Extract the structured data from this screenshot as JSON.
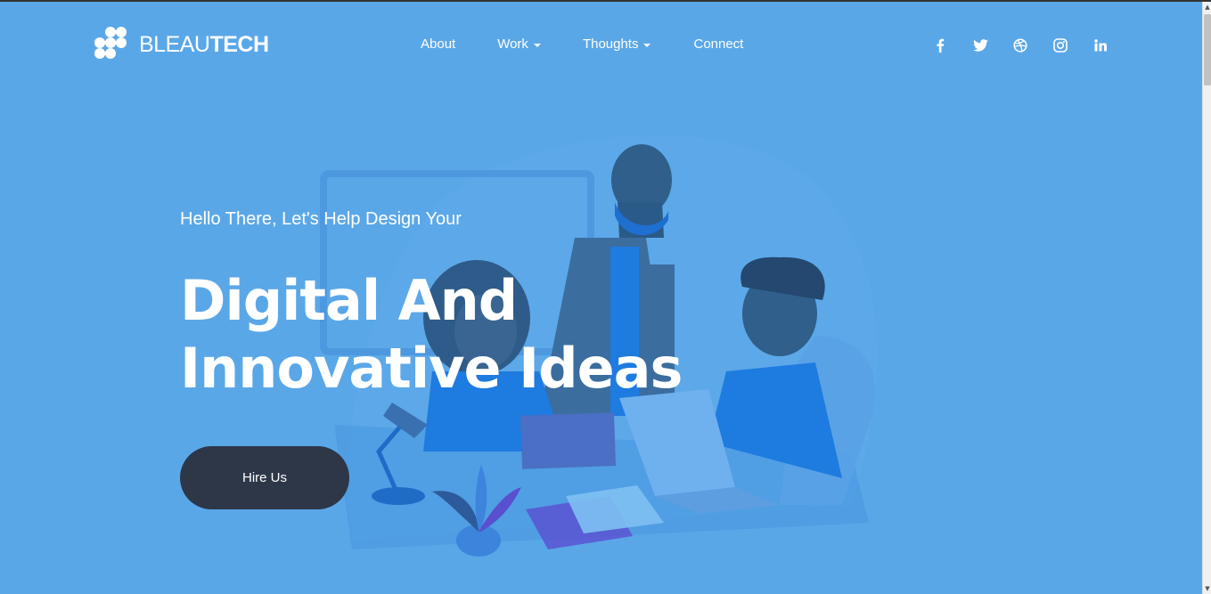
{
  "brand": {
    "light": "BLEAU",
    "bold": "TECH"
  },
  "nav": {
    "about": "About",
    "work": "Work",
    "thoughts": "Thoughts",
    "connect": "Connect"
  },
  "social": [
    "facebook-icon",
    "twitter-icon",
    "dribbble-icon",
    "instagram-icon",
    "linkedin-icon"
  ],
  "hero": {
    "subtitle": "Hello There, Let's Help Design Your",
    "title_line1": "Digital And",
    "title_line2": "Innovative Ideas",
    "cta": "Hire Us"
  },
  "colors": {
    "background": "#5aa7e8",
    "button": "#2d3748",
    "text": "#ffffff",
    "illustration_blue": "#1e7be0"
  }
}
